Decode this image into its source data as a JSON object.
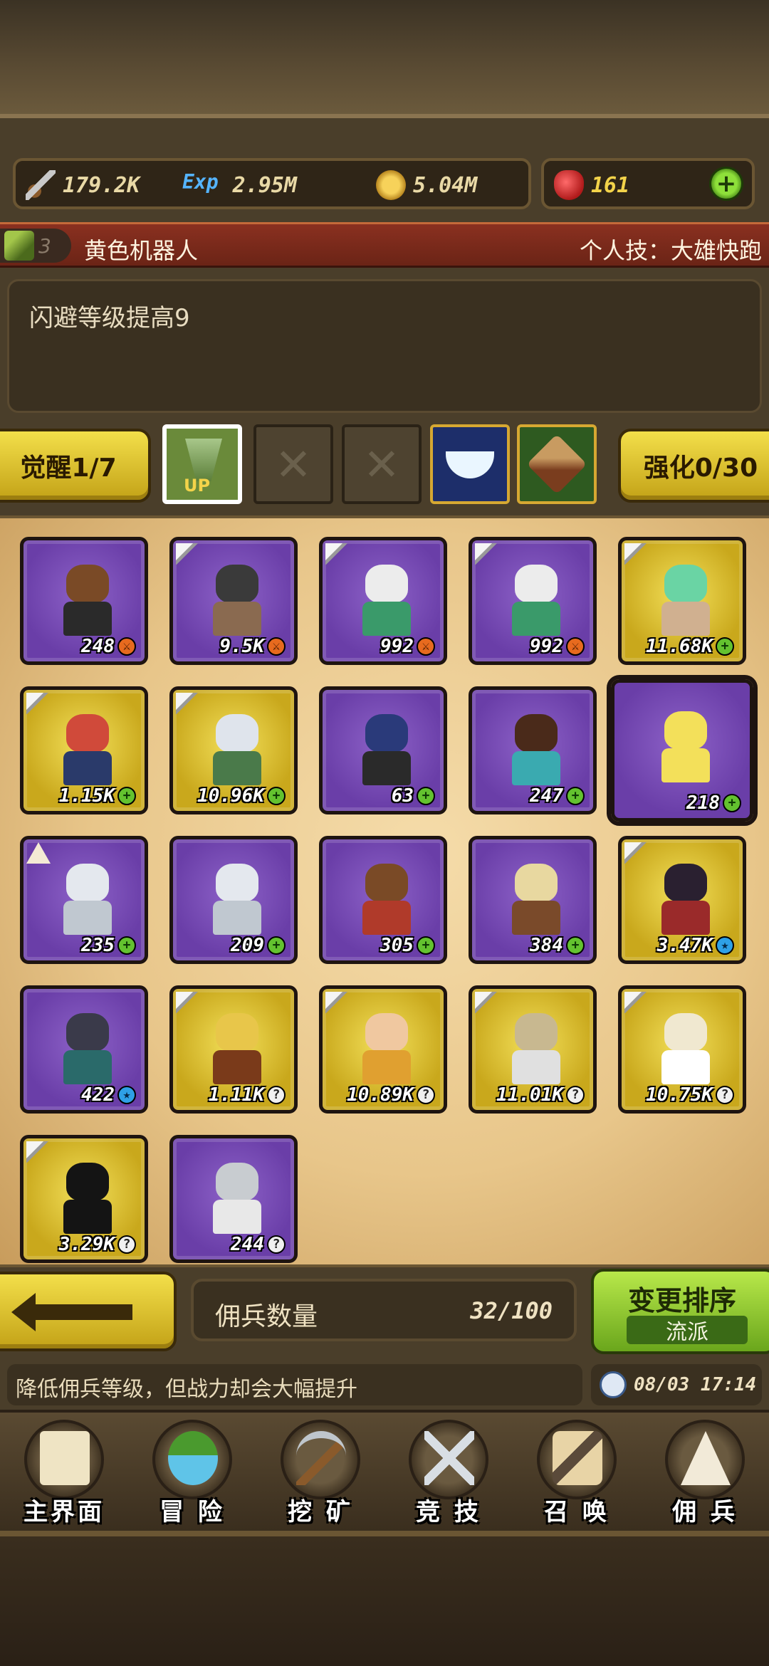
{
  "resources": {
    "power": "179.2K",
    "exp_label": "Exp",
    "exp": "2.95M",
    "gold": "5.04M",
    "gems": "161",
    "add_label": "+"
  },
  "hero": {
    "level": "3",
    "name": "黄色机器人",
    "skill": "个人技：大雄快跑",
    "description": "闪避等级提高9"
  },
  "awaken": {
    "awaken_label": "觉醒1/7",
    "upgrade_label": "强化0/30",
    "up_tag": "UP"
  },
  "mercenaries": [
    {
      "stat": "248",
      "badge": "⚔",
      "badge_color": "orange",
      "rarity": "purple",
      "sword": false,
      "head": "#7a4a26",
      "body": "#2a2a2a"
    },
    {
      "stat": "9.5K",
      "badge": "⚔",
      "badge_color": "orange",
      "rarity": "purple",
      "sword": true,
      "head": "#3a3a3a",
      "body": "#8a6a50"
    },
    {
      "stat": "992",
      "badge": "⚔",
      "badge_color": "orange",
      "rarity": "purple",
      "sword": true,
      "head": "#ececec",
      "body": "#3a9a6a"
    },
    {
      "stat": "992",
      "badge": "⚔",
      "badge_color": "orange",
      "rarity": "purple",
      "sword": true,
      "head": "#ececec",
      "body": "#3a9a6a"
    },
    {
      "stat": "11.68K",
      "badge": "+",
      "badge_color": "green",
      "rarity": "yellow",
      "sword": true,
      "head": "#6ad4a4",
      "body": "#d0b090"
    },
    {
      "stat": "1.15K",
      "badge": "+",
      "badge_color": "green",
      "rarity": "yellow",
      "sword": true,
      "head": "#d04a3a",
      "body": "#2a3a6a"
    },
    {
      "stat": "10.96K",
      "badge": "+",
      "badge_color": "green",
      "rarity": "yellow",
      "sword": true,
      "head": "#dfe4ec",
      "body": "#4a7a4a"
    },
    {
      "stat": "63",
      "badge": "+",
      "badge_color": "green",
      "rarity": "purple",
      "sword": false,
      "head": "#2a3a7a",
      "body": "#2a2a2a"
    },
    {
      "stat": "247",
      "badge": "+",
      "badge_color": "green",
      "rarity": "purple",
      "sword": false,
      "head": "#4a2a1a",
      "body": "#3aaab0"
    },
    {
      "stat": "218",
      "badge": "+",
      "badge_color": "green",
      "rarity": "purple",
      "sword": false,
      "selected": true,
      "head": "#f3e05a",
      "body": "#f3e05a"
    },
    {
      "stat": "235",
      "badge": "+",
      "badge_color": "green",
      "rarity": "purple",
      "sword": false,
      "tent": true,
      "head": "#e4e8ee",
      "body": "#c0c8d0"
    },
    {
      "stat": "209",
      "badge": "+",
      "badge_color": "green",
      "rarity": "purple",
      "sword": false,
      "head": "#e4e8ee",
      "body": "#c0c8d0"
    },
    {
      "stat": "305",
      "badge": "+",
      "badge_color": "green",
      "rarity": "purple",
      "sword": false,
      "head": "#7a4a26",
      "body": "#b03a2a"
    },
    {
      "stat": "384",
      "badge": "+",
      "badge_color": "green",
      "rarity": "purple",
      "sword": false,
      "head": "#e8d8a0",
      "body": "#7a4a2a"
    },
    {
      "stat": "3.47K",
      "badge": "★",
      "badge_color": "blue",
      "rarity": "yellow",
      "sword": true,
      "head": "#2a2030",
      "body": "#9a2a2a"
    },
    {
      "stat": "422",
      "badge": "★",
      "badge_color": "blue",
      "rarity": "purple",
      "sword": false,
      "head": "#3a3a4a",
      "body": "#2a6a6a"
    },
    {
      "stat": "1.11K",
      "badge": "?",
      "badge_color": "white",
      "rarity": "yellow",
      "sword": true,
      "head": "#e8c64a",
      "body": "#7a3a1a"
    },
    {
      "stat": "10.89K",
      "badge": "?",
      "badge_color": "white",
      "rarity": "yellow",
      "sword": true,
      "head": "#f0c8a0",
      "body": "#e0a030"
    },
    {
      "stat": "11.01K",
      "badge": "?",
      "badge_color": "white",
      "rarity": "yellow",
      "sword": true,
      "head": "#c8b890",
      "body": "#e0e0e0"
    },
    {
      "stat": "10.75K",
      "badge": "?",
      "badge_color": "white",
      "rarity": "yellow",
      "sword": true,
      "head": "#f0e8d0",
      "body": "#ffffff"
    },
    {
      "stat": "3.29K",
      "badge": "?",
      "badge_color": "white",
      "rarity": "yellow",
      "sword": true,
      "head": "#141414",
      "body": "#141414"
    },
    {
      "stat": "244",
      "badge": "?",
      "badge_color": "white",
      "rarity": "purple",
      "sword": false,
      "head": "#c8ccd0",
      "body": "#e8e8e8"
    }
  ],
  "controls": {
    "count_label": "佣兵数量",
    "count_value": "32/100",
    "sort_label": "变更排序",
    "sort_sub": "流派"
  },
  "ticker": {
    "text": "降低佣兵等级，但战力却会大幅提升",
    "datetime": "08/03 17:14"
  },
  "nav": [
    {
      "label": "主界面",
      "icon": "map-icon"
    },
    {
      "label": "冒 险",
      "icon": "adventure-icon"
    },
    {
      "label": "挖 矿",
      "icon": "pickaxe-icon"
    },
    {
      "label": "竞 技",
      "icon": "crossed-swords-icon"
    },
    {
      "label": "召 唤",
      "icon": "scroll-icon"
    },
    {
      "label": "佣 兵",
      "icon": "tent-icon"
    }
  ]
}
